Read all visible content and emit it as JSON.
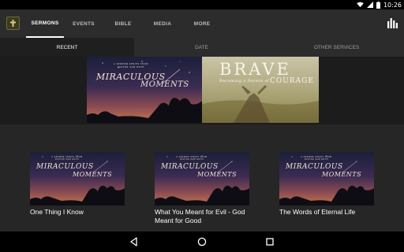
{
  "status_bar": {
    "time": "10:26",
    "icons": [
      "wifi-icon",
      "signal-icon",
      "battery-icon"
    ]
  },
  "app_bar": {
    "logo_icon": "church-logo-icon",
    "tabs": [
      {
        "label": "SERMONS",
        "active": true
      },
      {
        "label": "EVENTS",
        "active": false
      },
      {
        "label": "BIBLE",
        "active": false
      },
      {
        "label": "MEDIA",
        "active": false
      },
      {
        "label": "MORE",
        "active": false
      }
    ],
    "action_icon": "bar-chart-icon"
  },
  "sub_tabs": [
    {
      "label": "RECENT",
      "active": true
    },
    {
      "label": "DATE",
      "active": false
    },
    {
      "label": "OTHER SERVICES",
      "active": false
    }
  ],
  "featured": [
    {
      "series_tagline_1": "A SERMON SERIES FROM",
      "series_tagline_2": "PASTOR SAM ROTH",
      "title_line_1": "MIRACULOUS",
      "title_line_2": "MOMENTS"
    },
    {
      "title_word": "BRAVE",
      "subtitle_prefix": "Becoming a Person of",
      "subtitle_word": "COURAGE"
    }
  ],
  "sermons": [
    {
      "title": "One Thing I Know",
      "thumb": {
        "tagline_1": "A SERMON SERIES FROM",
        "tagline_2": "PASTOR SAM ROTH",
        "line_1": "MIRACULOUS",
        "line_2": "MOMENTS"
      }
    },
    {
      "title": "What You Meant for Evil - God Meant for Good",
      "thumb": {
        "tagline_1": "A SERMON SERIES FROM",
        "tagline_2": "PASTOR SAM ROTH",
        "line_1": "MIRACULOUS",
        "line_2": "MOMENTS"
      }
    },
    {
      "title": "The Words of Eternal Life",
      "thumb": {
        "tagline_1": "A SERMON SERIES FROM",
        "tagline_2": "PASTOR SAM ROTH",
        "line_1": "MIRACULOUS",
        "line_2": "MOMENTS"
      }
    }
  ],
  "nav_bar": {
    "back_icon": "back-triangle-icon",
    "home_icon": "home-circle-icon",
    "recents_icon": "recents-square-icon"
  },
  "colors": {
    "app_bar": "#2c2c2c",
    "background": "#262626",
    "active_indicator": "#ffffff",
    "inactive_text": "#bdbdbd"
  }
}
